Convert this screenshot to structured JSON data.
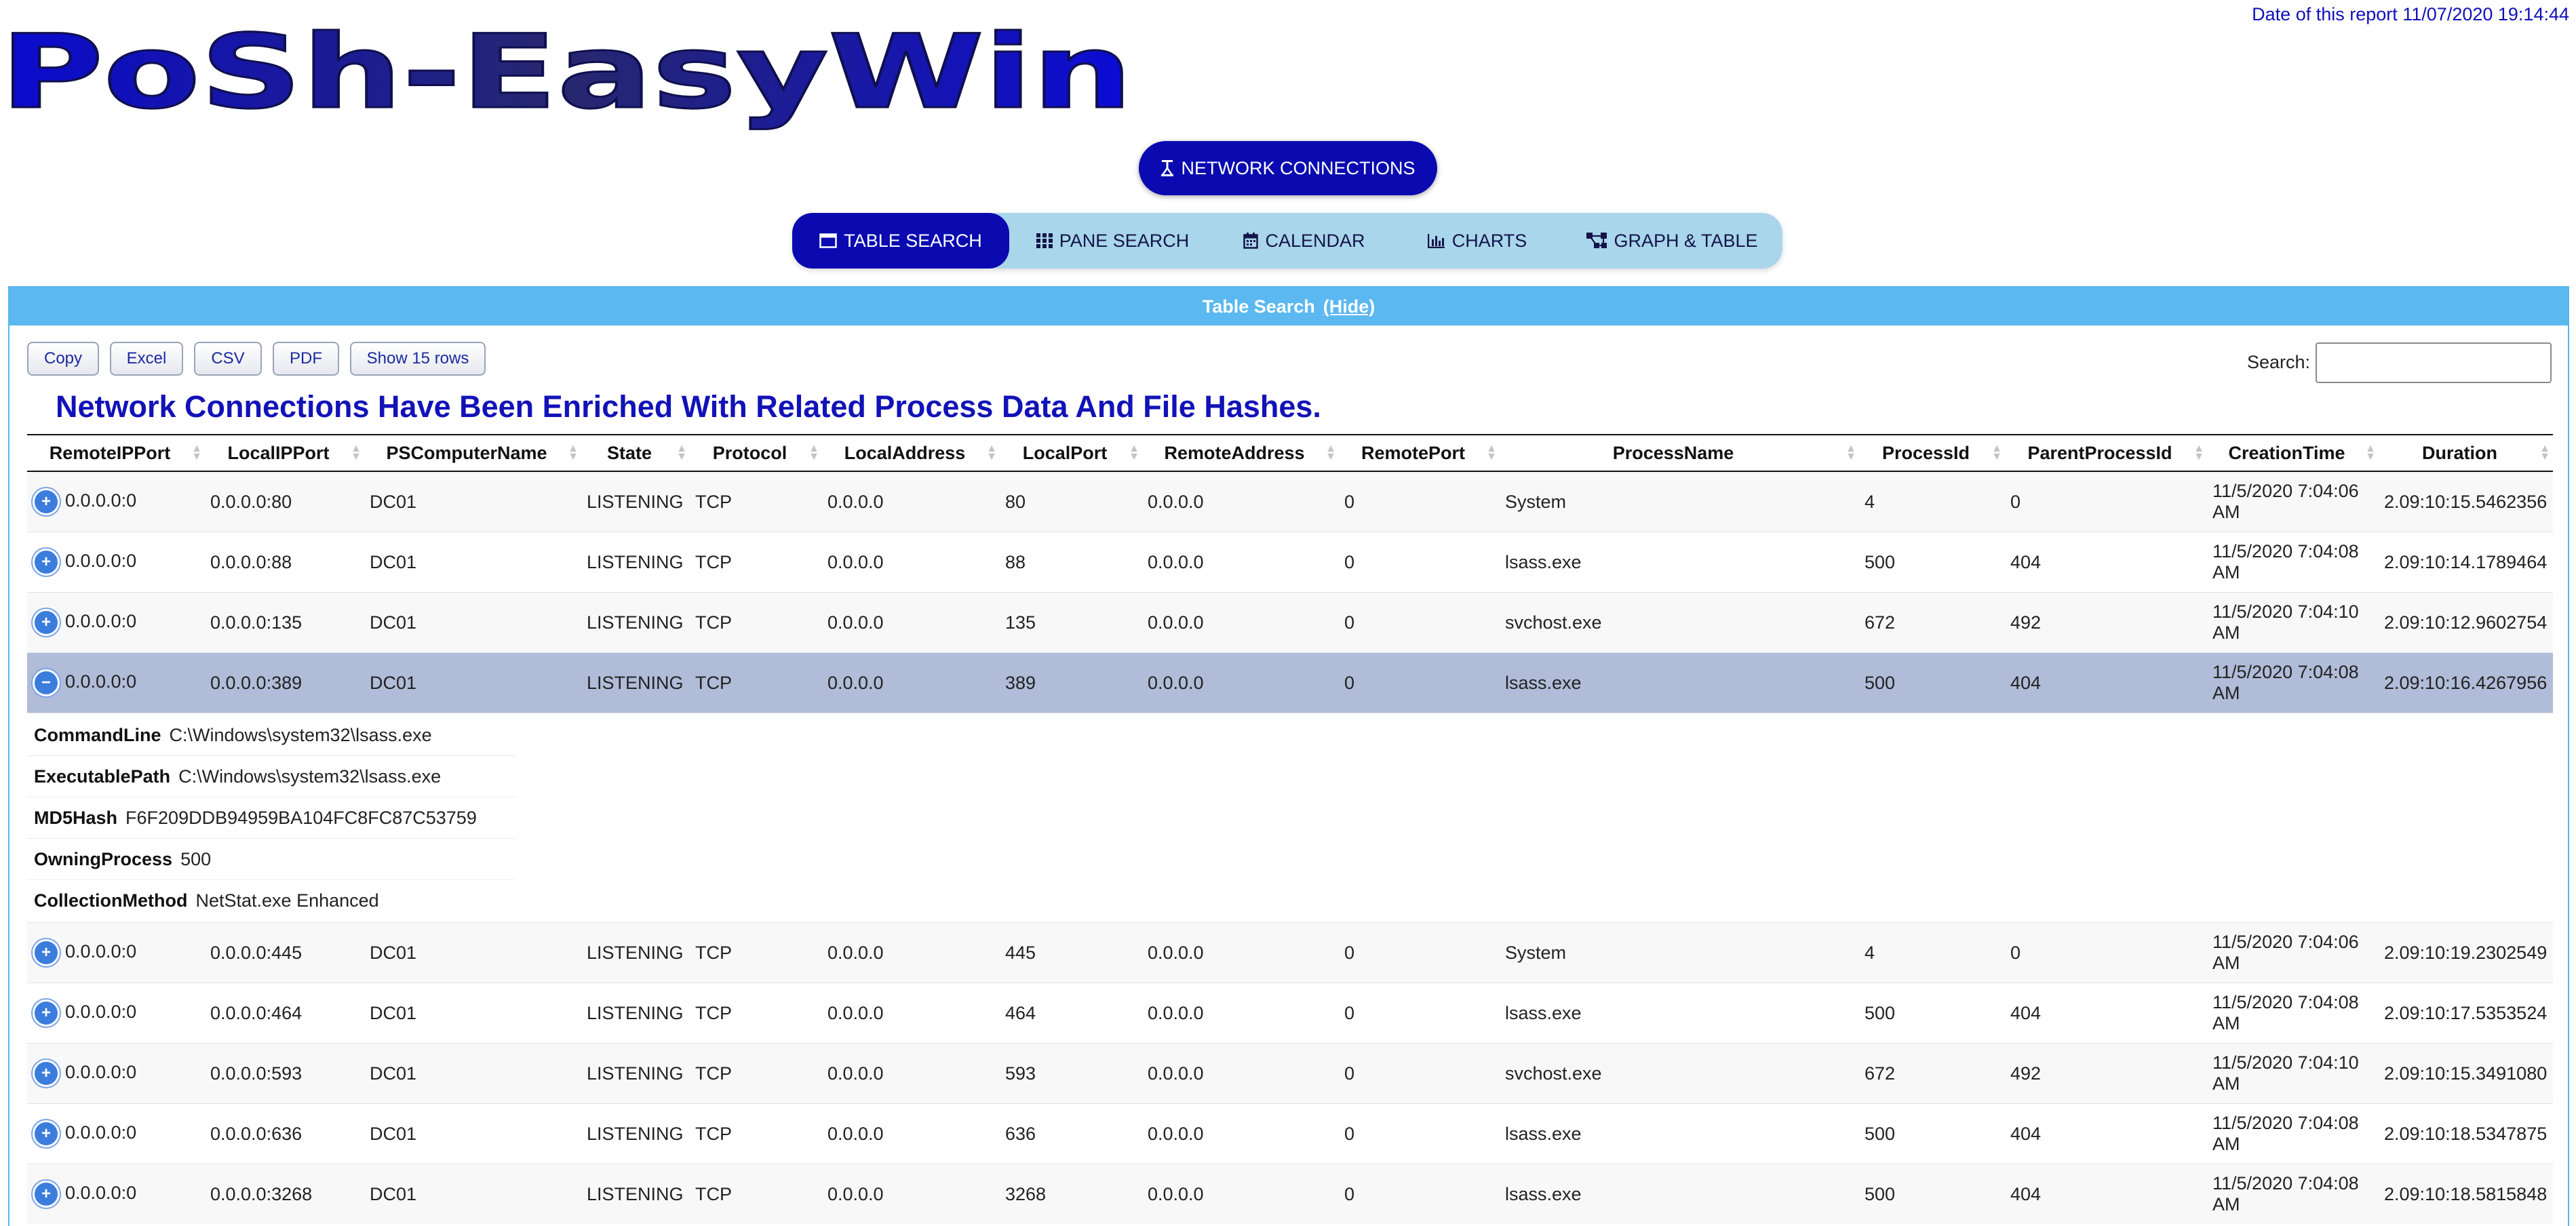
{
  "header": {
    "report_date": "Date of this report 11/07/2020 19:14:44",
    "logo_text": "PoSh-EasyWin",
    "page_button": "NETWORK CONNECTIONS"
  },
  "nav": {
    "tabs": [
      {
        "label": "TABLE SEARCH",
        "icon": "window-icon"
      },
      {
        "label": "PANE SEARCH",
        "icon": "grid-icon"
      },
      {
        "label": "CALENDAR",
        "icon": "calendar-icon"
      },
      {
        "label": "CHARTS",
        "icon": "bar-chart-icon"
      },
      {
        "label": "GRAPH & TABLE",
        "icon": "graph-nodes-icon"
      }
    ]
  },
  "panel": {
    "title": "Table Search",
    "hide_link": "(Hide)"
  },
  "toolbar": {
    "copy": "Copy",
    "excel": "Excel",
    "csv": "CSV",
    "pdf": "PDF",
    "show_rows": "Show 15 rows",
    "search_label": "Search:",
    "search_value": ""
  },
  "table": {
    "title": "Network Connections Have Been Enriched With Related Process Data And File Hashes.",
    "columns": [
      "RemoteIPPort",
      "LocalIPPort",
      "PSComputerName",
      "State",
      "Protocol",
      "LocalAddress",
      "LocalPort",
      "RemoteAddress",
      "RemotePort",
      "ProcessName",
      "ProcessId",
      "ParentProcessId",
      "CreationTime",
      "Duration"
    ],
    "rows_top": [
      [
        "0.0.0.0:0",
        "0.0.0.0:80",
        "DC01",
        "LISTENING",
        "TCP",
        "0.0.0.0",
        "80",
        "0.0.0.0",
        "0",
        "System",
        "4",
        "0",
        "11/5/2020 7:04:06 AM",
        "2.09:10:15.5462356"
      ],
      [
        "0.0.0.0:0",
        "0.0.0.0:88",
        "DC01",
        "LISTENING",
        "TCP",
        "0.0.0.0",
        "88",
        "0.0.0.0",
        "0",
        "lsass.exe",
        "500",
        "404",
        "11/5/2020 7:04:08 AM",
        "2.09:10:14.1789464"
      ],
      [
        "0.0.0.0:0",
        "0.0.0.0:135",
        "DC01",
        "LISTENING",
        "TCP",
        "0.0.0.0",
        "135",
        "0.0.0.0",
        "0",
        "svchost.exe",
        "672",
        "492",
        "11/5/2020 7:04:10 AM",
        "2.09:10:12.9602754"
      ],
      [
        "0.0.0.0:0",
        "0.0.0.0:389",
        "DC01",
        "LISTENING",
        "TCP",
        "0.0.0.0",
        "389",
        "0.0.0.0",
        "0",
        "lsass.exe",
        "500",
        "404",
        "11/5/2020 7:04:08 AM",
        "2.09:10:16.4267956"
      ]
    ],
    "detail": [
      {
        "key": "CommandLine",
        "value": "C:\\Windows\\system32\\lsass.exe"
      },
      {
        "key": "ExecutablePath",
        "value": "C:\\Windows\\system32\\lsass.exe"
      },
      {
        "key": "MD5Hash",
        "value": "F6F209DDB94959BA104FC8FC87C53759"
      },
      {
        "key": "OwningProcess",
        "value": "500"
      },
      {
        "key": "CollectionMethod",
        "value": "NetStat.exe Enhanced"
      }
    ],
    "rows_bottom": [
      [
        "0.0.0.0:0",
        "0.0.0.0:445",
        "DC01",
        "LISTENING",
        "TCP",
        "0.0.0.0",
        "445",
        "0.0.0.0",
        "0",
        "System",
        "4",
        "0",
        "11/5/2020 7:04:06 AM",
        "2.09:10:19.2302549"
      ],
      [
        "0.0.0.0:0",
        "0.0.0.0:464",
        "DC01",
        "LISTENING",
        "TCP",
        "0.0.0.0",
        "464",
        "0.0.0.0",
        "0",
        "lsass.exe",
        "500",
        "404",
        "11/5/2020 7:04:08 AM",
        "2.09:10:17.5353524"
      ],
      [
        "0.0.0.0:0",
        "0.0.0.0:593",
        "DC01",
        "LISTENING",
        "TCP",
        "0.0.0.0",
        "593",
        "0.0.0.0",
        "0",
        "svchost.exe",
        "672",
        "492",
        "11/5/2020 7:04:10 AM",
        "2.09:10:15.3491080"
      ],
      [
        "0.0.0.0:0",
        "0.0.0.0:636",
        "DC01",
        "LISTENING",
        "TCP",
        "0.0.0.0",
        "636",
        "0.0.0.0",
        "0",
        "lsass.exe",
        "500",
        "404",
        "11/5/2020 7:04:08 AM",
        "2.09:10:18.5347875"
      ],
      [
        "0.0.0.0:0",
        "0.0.0.0:3268",
        "DC01",
        "LISTENING",
        "TCP",
        "0.0.0.0",
        "3268",
        "0.0.0.0",
        "0",
        "lsass.exe",
        "500",
        "404",
        "11/5/2020 7:04:08 AM",
        "2.09:10:18.5815848"
      ]
    ]
  }
}
